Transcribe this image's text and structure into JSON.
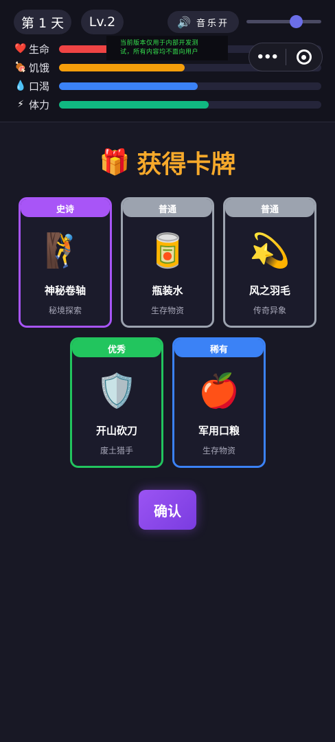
{
  "header": {
    "day_label": "第 1 天",
    "level_label": "Lv.2",
    "music_icon": "🔊",
    "music_label": "音乐开",
    "music_volume_percent": 70
  },
  "stats": [
    {
      "icon": "❤️",
      "icon_name": "heart-icon",
      "label": "生命",
      "percent": 23,
      "color": "#ef4444"
    },
    {
      "icon": "🍖",
      "icon_name": "meat-icon",
      "label": "饥饿",
      "percent": 48,
      "color": "#f59e0b"
    },
    {
      "icon": "💧",
      "icon_name": "water-drop-icon",
      "label": "口渴",
      "percent": 53,
      "color": "#3b82f6"
    },
    {
      "icon": "⚡",
      "icon_name": "lightning-icon",
      "label": "体力",
      "percent": 57,
      "color": "#10b981"
    }
  ],
  "notice": {
    "line1": "当前版本仅用于内部开发测",
    "line2": "试，所有内容均不面向用户"
  },
  "capsule": {
    "more_icon": "•••",
    "close_icon_name": "target-icon"
  },
  "reward": {
    "gift_icon": "🎁",
    "title": "获得卡牌"
  },
  "cards": [
    {
      "rarity": "史诗",
      "color": "#a855f7",
      "emoji": "🧗",
      "icon_name": "climber-icon",
      "name": "神秘卷轴",
      "category": "秘境探索"
    },
    {
      "rarity": "普通",
      "color": "#9ca3af",
      "emoji": "🥫",
      "icon_name": "canned-food-icon",
      "name": "瓶装水",
      "category": "生存物资"
    },
    {
      "rarity": "普通",
      "color": "#9ca3af",
      "emoji": "💫",
      "icon_name": "dizzy-star-icon",
      "name": "风之羽毛",
      "category": "传奇异象"
    },
    {
      "rarity": "优秀",
      "color": "#22c55e",
      "emoji": "🛡️",
      "icon_name": "shield-icon",
      "name": "开山砍刀",
      "category": "废土猎手"
    },
    {
      "rarity": "稀有",
      "color": "#3b82f6",
      "emoji": "🍎",
      "icon_name": "apple-icon",
      "name": "军用口粮",
      "category": "生存物资"
    }
  ],
  "confirm_label": "确认"
}
